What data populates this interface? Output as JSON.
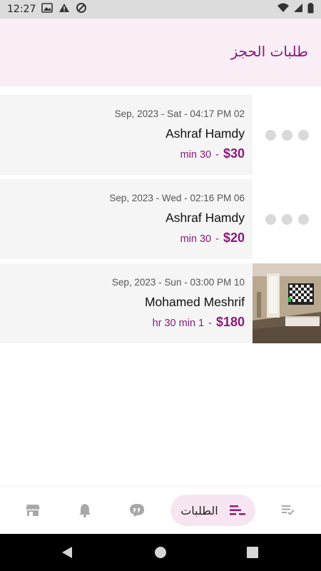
{
  "status_bar": {
    "time": "12:27",
    "left_icons": [
      "gallery-icon",
      "warning-icon",
      "blocked-icon"
    ],
    "right_icons": [
      "wifi-icon",
      "signal-icon",
      "battery-icon"
    ]
  },
  "header": {
    "title": "طلبات الحجز"
  },
  "bookings": [
    {
      "date": "Sep, 2023 - Sat - 04:17 PM 02",
      "name": "Ashraf Hamdy",
      "duration": "min 30",
      "separator": "-",
      "price": "$30",
      "thumbnail": "placeholder-dots"
    },
    {
      "date": "Sep, 2023 - Wed - 02:16 PM 06",
      "name": "Ashraf Hamdy",
      "duration": "min 30",
      "separator": "-",
      "price": "$20",
      "thumbnail": "placeholder-dots"
    },
    {
      "date": "Sep, 2023 - Sun - 03:00 PM 10",
      "name": "Mohamed Meshrif",
      "duration": "hr 30 min 1",
      "separator": "-",
      "price": "$180",
      "thumbnail": "room-photo"
    }
  ],
  "bottom_nav": {
    "items": [
      {
        "icon": "store-icon"
      },
      {
        "icon": "bell-icon"
      },
      {
        "icon": "chat-bubble-icon"
      },
      {
        "icon": "list-icon",
        "label": "الطلبات",
        "active": true
      },
      {
        "icon": "checklist-icon"
      }
    ]
  },
  "system_nav": [
    "back-icon",
    "home-icon",
    "recents-icon"
  ],
  "colors": {
    "accent": "#8b1a7a",
    "header_bg": "#f9eef5",
    "active_pill": "#f7e6f1",
    "card_bg": "#f5f5f5"
  }
}
